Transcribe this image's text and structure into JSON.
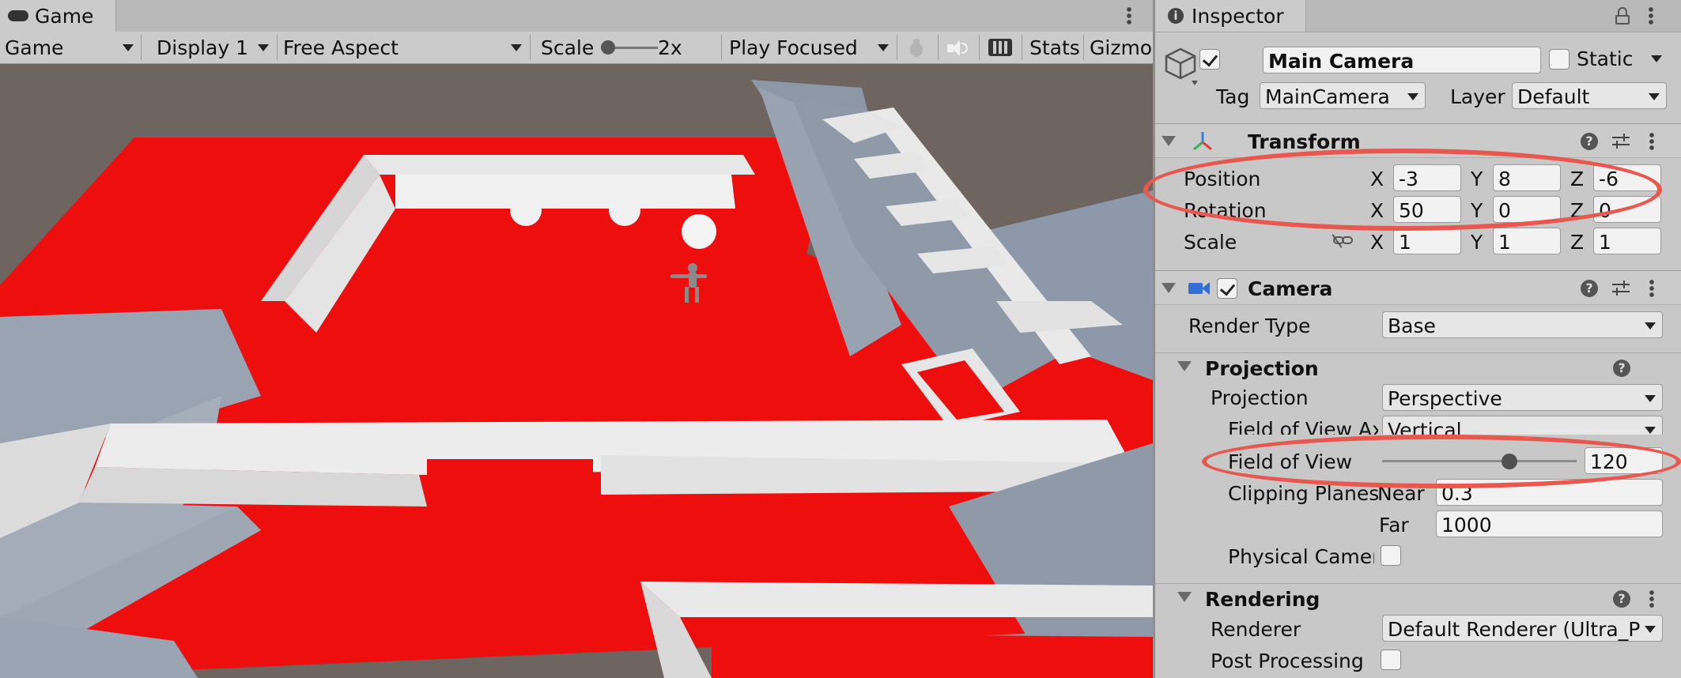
{
  "game_window": {
    "tab_label": "Game",
    "toolbar": {
      "mode_label": "Game",
      "display_label": "Display 1",
      "aspect_label": "Free Aspect",
      "scale_label": "Scale",
      "scale_value": "2x",
      "scale_slider_level": 0.0,
      "play_focus_label": "Play Focused",
      "stats_label": "Stats",
      "gizmos_label": "Gizmos"
    }
  },
  "inspector": {
    "tab_label": "Inspector",
    "object": {
      "active": true,
      "name": "Main Camera",
      "static_label": "Static",
      "static_checked": false,
      "tag_label": "Tag",
      "tag_value": "MainCamera",
      "layer_label": "Layer",
      "layer_value": "Default"
    },
    "transform": {
      "title": "Transform",
      "position": {
        "label": "Position",
        "x": "-3",
        "y": "8",
        "z": "-6"
      },
      "rotation": {
        "label": "Rotation",
        "x": "50",
        "y": "0",
        "z": "0"
      },
      "scale": {
        "label": "Scale",
        "x": "1",
        "y": "1",
        "z": "1"
      },
      "axis_x": "X",
      "axis_y": "Y",
      "axis_z": "Z"
    },
    "camera": {
      "title": "Camera",
      "enabled": true,
      "render_type_label": "Render Type",
      "render_type_value": "Base",
      "projection_section": "Projection",
      "projection_label": "Projection",
      "projection_value": "Perspective",
      "fov_axis_label": "Field of View Axis",
      "fov_axis_value": "Vertical",
      "fov_label": "Field of View",
      "fov_value": "120",
      "fov_slider_level": 0.66,
      "clip_label": "Clipping Planes",
      "near_label": "Near",
      "near_value": "0.3",
      "far_label": "Far",
      "far_value": "1000",
      "physical_label": "Physical Camera",
      "physical_checked": false,
      "rendering_section": "Rendering",
      "renderer_label": "Renderer",
      "renderer_value": "Default Renderer (Ultra_Pipeline)",
      "post_processing_label": "Post Processing",
      "post_processing_checked": false
    }
  },
  "colors": {
    "floor_red": "#ef0e0e",
    "sky": "#6e6560",
    "highlight": "#e8584f",
    "panel_bg": "#c8c8c8"
  }
}
